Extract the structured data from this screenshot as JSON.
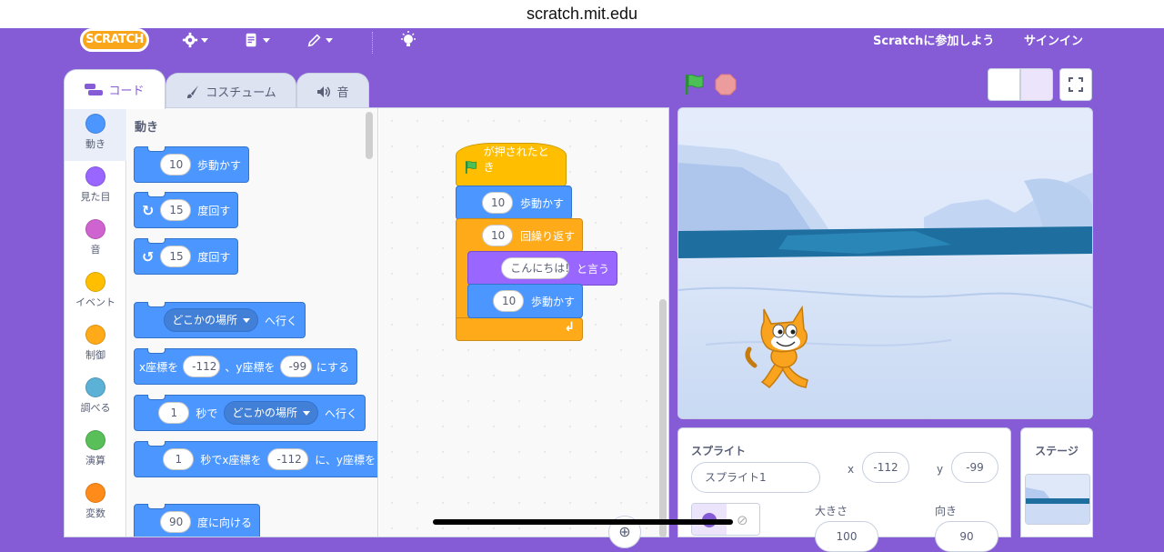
{
  "browser": {
    "url": "scratch.mit.edu"
  },
  "menubar": {
    "logo": "SCRATCH",
    "join": "Scratchに参加しよう",
    "signin": "サインイン"
  },
  "tabs": [
    {
      "label": "コード"
    },
    {
      "label": "コスチューム"
    },
    {
      "label": "音"
    }
  ],
  "categories": [
    {
      "label": "動き",
      "color": "#4c97ff"
    },
    {
      "label": "見た目",
      "color": "#9966ff"
    },
    {
      "label": "音",
      "color": "#cf63cf"
    },
    {
      "label": "イベント",
      "color": "#ffbf00"
    },
    {
      "label": "制御",
      "color": "#ffab19"
    },
    {
      "label": "調べる",
      "color": "#5cb1d6"
    },
    {
      "label": "演算",
      "color": "#59c059"
    },
    {
      "label": "変数",
      "color": "#ff8c1a"
    }
  ],
  "palette": {
    "title": "動き",
    "move": {
      "value": "10",
      "text": "歩動かす"
    },
    "turn_right": {
      "value": "15",
      "text": "度回す"
    },
    "turn_left": {
      "value": "15",
      "text": "度回す"
    },
    "goto": {
      "dropdown": "どこかの場所",
      "text": "へ行く"
    },
    "goto_xy": {
      "pre": "x座標を",
      "x": "-112",
      "mid": "、y座標を",
      "y": "-99",
      "post": "にする"
    },
    "glide": {
      "secs": "1",
      "pre": "秒で",
      "dropdown": "どこかの場所",
      "post": "へ行く"
    },
    "glide_xy": {
      "secs": "1",
      "pre": "秒でx座標を",
      "x": "-112",
      "mid": "に、y座標を"
    },
    "point": {
      "value": "90",
      "text": "度に向ける"
    }
  },
  "script": {
    "hat": "が押されたとき",
    "move1": {
      "value": "10",
      "text": "歩動かす"
    },
    "repeat": {
      "value": "10",
      "text": "回繰り返す"
    },
    "say": {
      "value": "こんにちは!",
      "text": "と言う"
    },
    "move2": {
      "value": "10",
      "text": "歩動かす"
    }
  },
  "sprite_info": {
    "label": "スプライト",
    "name": "スプライト1",
    "x_label": "x",
    "x": "-112",
    "y_label": "y",
    "y": "-99",
    "size_label": "大きさ",
    "size": "100",
    "direction_label": "向き",
    "direction": "90"
  },
  "stage_panel": {
    "label": "ステージ"
  },
  "colors": {
    "accent": "#855cd6",
    "motion": "#4c97ff",
    "events": "#ffbf00",
    "control": "#ffab19",
    "looks": "#9966ff"
  }
}
